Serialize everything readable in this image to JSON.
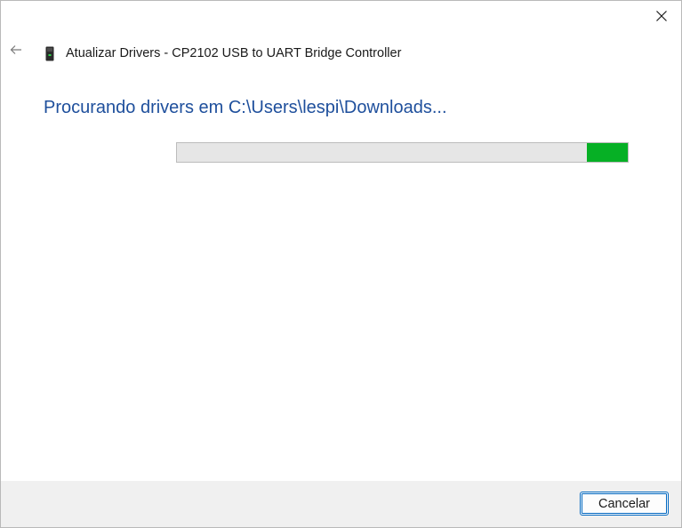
{
  "window": {
    "header_title": "Atualizar Drivers - CP2102 USB to UART Bridge Controller"
  },
  "icons": {
    "close": "close-icon",
    "back": "back-arrow-icon",
    "device": "usb-device-icon"
  },
  "main": {
    "heading": "Procurando drivers em C:\\Users\\lespi\\Downloads...",
    "progress": {
      "mode": "indeterminate",
      "color": "#06b025",
      "track_color": "#e6e6e6"
    }
  },
  "footer": {
    "cancel_label": "Cancelar"
  },
  "colors": {
    "heading": "#1e4f9c",
    "focus_border": "#0067c0",
    "footer_background": "#f0f0f0"
  }
}
